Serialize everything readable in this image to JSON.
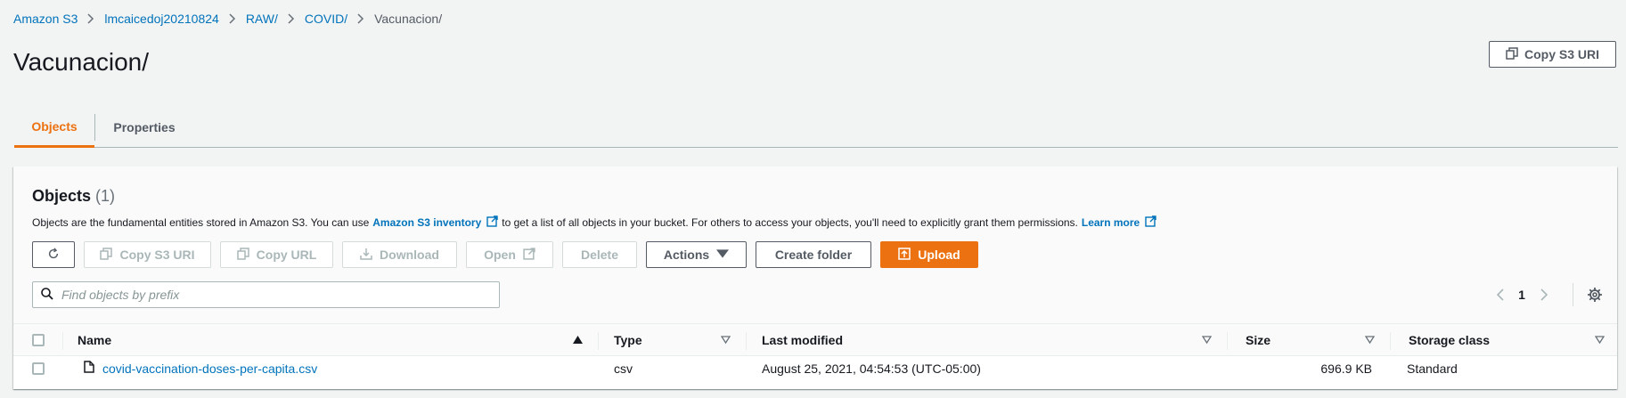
{
  "breadcrumb": {
    "items": [
      "Amazon S3",
      "lmcaicedoj20210824",
      "RAW/",
      "COVID/",
      "Vacunacion/"
    ]
  },
  "header": {
    "title": "Vacunacion/",
    "copy_uri_label": "Copy S3 URI"
  },
  "tabs": [
    {
      "label": "Objects",
      "active": true
    },
    {
      "label": "Properties",
      "active": false
    }
  ],
  "objects_panel": {
    "title": "Objects",
    "count": "(1)",
    "description_part1": "Objects are the fundamental entities stored in Amazon S3. You can use",
    "inventory_link": "Amazon S3 inventory",
    "description_part2": "to get a list of all objects in your bucket. For others to access your objects, you'll need to explicitly grant them permissions.",
    "learn_more": "Learn more"
  },
  "toolbar": {
    "copy_s3_uri": "Copy S3 URI",
    "copy_url": "Copy URL",
    "download": "Download",
    "open": "Open",
    "delete": "Delete",
    "actions": "Actions",
    "create_folder": "Create folder",
    "upload": "Upload"
  },
  "search": {
    "placeholder": "Find objects by prefix",
    "value": ""
  },
  "pagination": {
    "current_page": "1"
  },
  "table": {
    "columns": [
      "Name",
      "Type",
      "Last modified",
      "Size",
      "Storage class"
    ],
    "rows": [
      {
        "name": "covid-vaccination-doses-per-capita.csv",
        "type": "csv",
        "last_modified": "August 25, 2021, 04:54:53 (UTC-05:00)",
        "size": "696.9 KB",
        "storage_class": "Standard"
      }
    ]
  },
  "colors": {
    "link": "#0073bb",
    "accent": "#ec7211",
    "text": "#16191f",
    "muted": "#545b64",
    "disabled": "#aab7b8"
  },
  "icons": [
    "chevron-right-icon",
    "copy-icon",
    "external-link-icon",
    "refresh-icon",
    "download-icon",
    "caret-down-icon",
    "upload-icon",
    "search-icon",
    "chevron-left-icon",
    "gear-icon",
    "sort-asc-icon",
    "sort-icon",
    "file-icon"
  ]
}
